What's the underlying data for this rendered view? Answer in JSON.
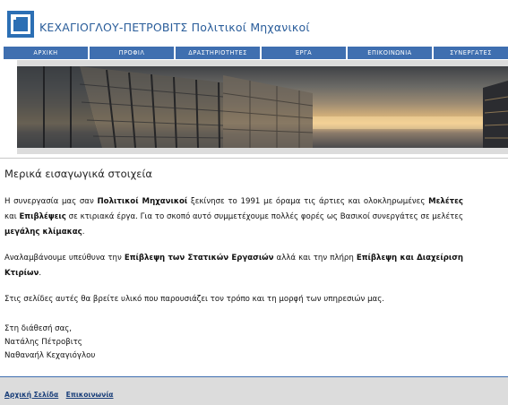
{
  "header": {
    "title": "ΚΕΧΑΓΙΟΓΛΟΥ-ΠΕΤΡΟΒΙΤΣ Πολιτικοί Μηχανικοί"
  },
  "nav": {
    "items": [
      "ΑΡΧΙΚΗ",
      "ΠΡΟΦΙΛ",
      "ΔΡΑΣΤΗΡΙΟΤΗΤΕΣ",
      "ΕΡΓΑ",
      "ΕΠΙΚΟΙΝΩΝΙΑ",
      "ΣΥΝΕΡΓΑΤΕΣ"
    ]
  },
  "colors": {
    "nav_bg": "#3f6fb0",
    "title": "#2a5d9a",
    "footer_bg": "#dcdcdc"
  },
  "content": {
    "heading": "Μερικά εισαγωγικά στοιχεία",
    "p1": {
      "t1": "Η συνεργασία μας σαν ",
      "b1": "Πολιτικοί Μηχανικοί",
      "t2": " ξεκίνησε το 1991 με όραμα τις άρτιες και ολοκληρωμένες ",
      "b2": "Μελέτες",
      "t3": " και ",
      "b3": "Επιβλέψεις",
      "t4": " σε κτιριακά έργα. Για το σκοπό αυτό συμμετέχουμε πολλές φορές ως Βασικοί συνεργάτες σε μελέτες ",
      "b4": "μεγάλης κλίμακας",
      "t5": "."
    },
    "p2": {
      "t1": "Αναλαμβάνουμε υπεύθυνα την ",
      "b1": "Επίβλεψη των Στατικών Εργασιών",
      "t2": " αλλά και την πλήρη ",
      "b2": "Επίβλεψη και Διαχείριση Κτιρίων",
      "t3": "."
    },
    "p3": "Στις σελίδες αυτές θα βρείτε υλικό που παρουσιάζει τον τρόπο και τη μορφή των υπηρεσιών μας.",
    "signature": [
      "Στη διάθεσή σας,",
      "Νατάλης Πέτροβιτς",
      "Ναθαναήλ Κεχαγιόγλου"
    ]
  },
  "footer": {
    "links": [
      "Αρχική Σελίδα",
      "Επικοινωνία"
    ]
  }
}
